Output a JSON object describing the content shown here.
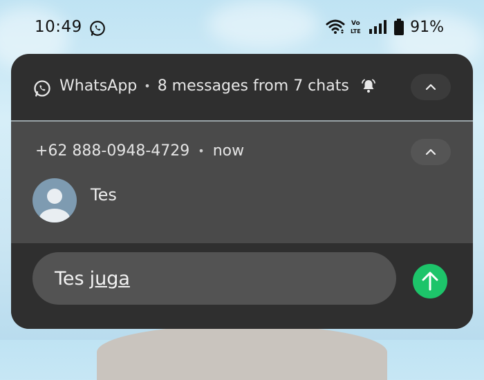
{
  "status_bar": {
    "time": "10:49",
    "battery_percent": "91%",
    "icons": [
      "whatsapp-icon",
      "wifi-icon",
      "volte-icon",
      "signal-icon",
      "battery-icon"
    ]
  },
  "notification": {
    "app_name": "WhatsApp",
    "summary": "8 messages from 7 chats",
    "separator": "•",
    "sender": "+62 888-0948-4729",
    "time": "now",
    "message": "Tes",
    "reply": {
      "text_plain": "Tes",
      "text_underlined": "juga"
    }
  },
  "colors": {
    "panel": "#2f2f2f",
    "conversation": "#4a4a4a",
    "input": "#535353",
    "send_button": "#1dc46a",
    "avatar": "#7e9bb1"
  }
}
